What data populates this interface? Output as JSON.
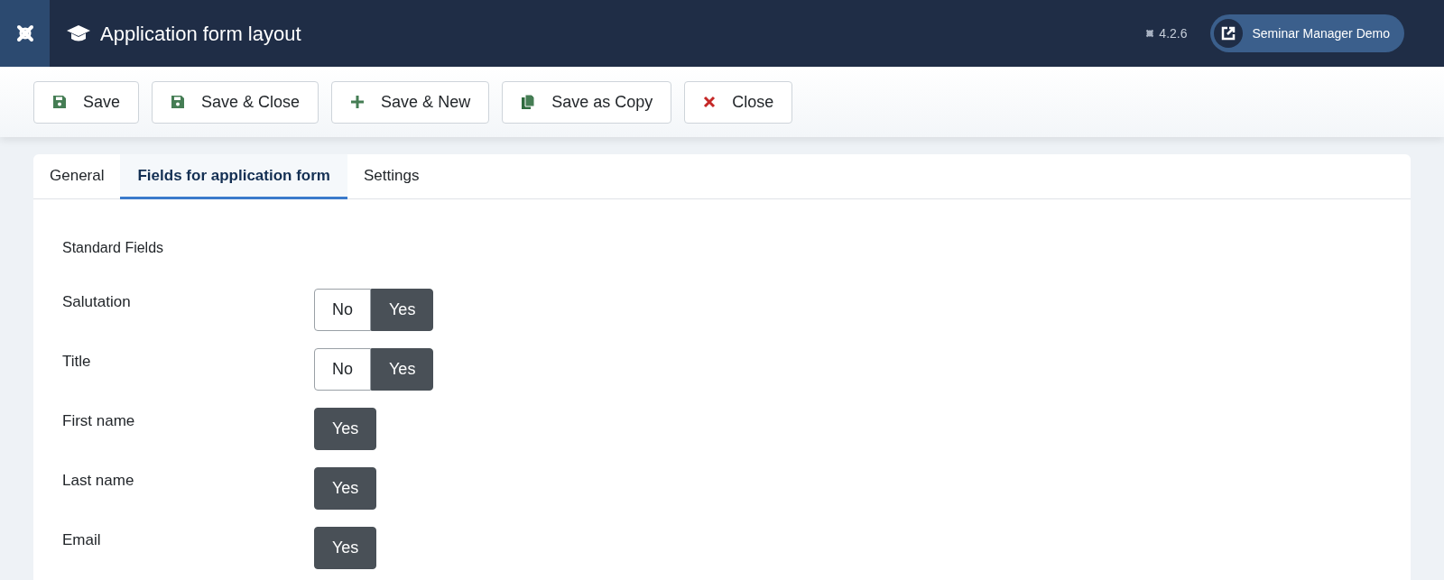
{
  "header": {
    "title": "Application form layout",
    "version": "4.2.6",
    "site_link": "Seminar Manager Demo"
  },
  "toolbar": [
    {
      "label": "Save",
      "kind": "save"
    },
    {
      "label": "Save & Close",
      "kind": "save"
    },
    {
      "label": "Save & New",
      "kind": "new"
    },
    {
      "label": "Save as Copy",
      "kind": "copy"
    },
    {
      "label": "Close",
      "kind": "close"
    }
  ],
  "tabs": [
    {
      "label": "General",
      "selected": false
    },
    {
      "label": "Fields for application form",
      "selected": true
    },
    {
      "label": "Settings",
      "selected": false
    }
  ],
  "section_title": "Standard Fields",
  "fields": [
    {
      "label": "Salutation",
      "options": [
        {
          "label": "No",
          "selected": false
        },
        {
          "label": "Yes",
          "selected": true
        }
      ]
    },
    {
      "label": "Title",
      "options": [
        {
          "label": "No",
          "selected": false
        },
        {
          "label": "Yes",
          "selected": true
        }
      ]
    },
    {
      "label": "First name",
      "options": [
        {
          "label": "Yes",
          "selected": true
        }
      ]
    },
    {
      "label": "Last name",
      "options": [
        {
          "label": "Yes",
          "selected": true
        }
      ]
    },
    {
      "label": "Email",
      "options": [
        {
          "label": "Yes",
          "selected": true
        }
      ]
    }
  ]
}
